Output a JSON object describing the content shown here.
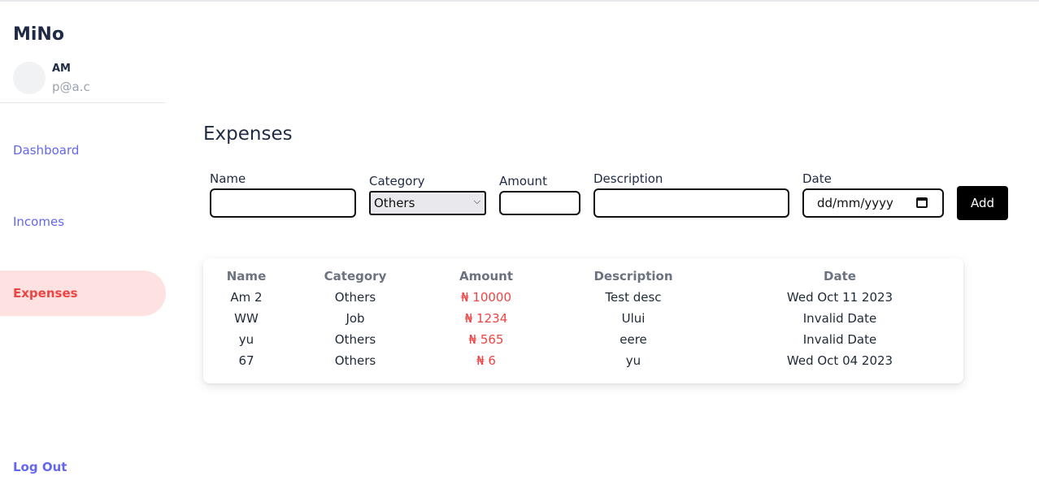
{
  "app": {
    "brand": "MiNo"
  },
  "user": {
    "initials": "AM",
    "email": "p@a.c"
  },
  "nav": {
    "dashboard": "Dashboard",
    "incomes": "Incomes",
    "expenses": "Expenses",
    "logout": "Log Out"
  },
  "page": {
    "title": "Expenses"
  },
  "form": {
    "name_label": "Name",
    "category_label": "Category",
    "category_value": "Others",
    "amount_label": "Amount",
    "description_label": "Description",
    "date_label": "Date",
    "date_placeholder": "dd/mm/yyyy",
    "add_label": "Add"
  },
  "table": {
    "headers": [
      "Name",
      "Category",
      "Amount",
      "Description",
      "Date"
    ],
    "rows": [
      [
        "Am 2",
        "Others",
        "₦ 10000",
        "Test desc",
        "Wed Oct 11 2023"
      ],
      [
        "WW",
        "Job",
        "₦ 1234",
        "Ului",
        "Invalid Date"
      ],
      [
        "yu",
        "Others",
        "₦ 565",
        "eere",
        "Invalid Date"
      ],
      [
        "67",
        "Others",
        "₦ 6",
        "yu",
        "Wed Oct 04 2023"
      ]
    ]
  },
  "colors": {
    "accent": "#6366f1",
    "active_bg": "#fee2e2",
    "danger": "#ef4444",
    "muted": "#6b7280"
  }
}
